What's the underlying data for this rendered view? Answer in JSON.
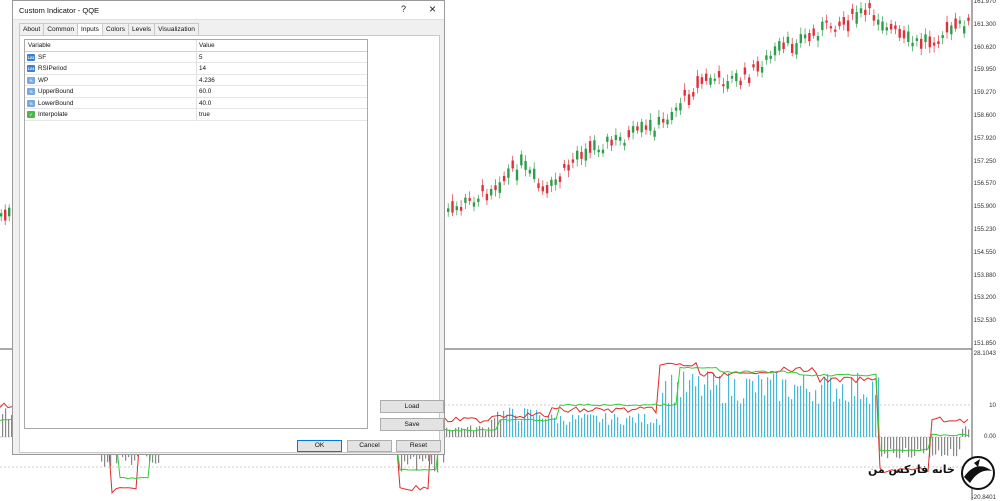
{
  "dialog": {
    "title": "Custom Indicator - QQE",
    "help": "?",
    "close": "×",
    "tabs": [
      "About",
      "Common",
      "Inputs",
      "Colors",
      "Levels",
      "Visualization"
    ],
    "active_tab": "Inputs",
    "grid": {
      "headers": {
        "variable": "Variable",
        "value": "Value"
      },
      "rows": [
        {
          "icon": "number-123-icon",
          "variable": "SF",
          "value": "5"
        },
        {
          "icon": "number-123-icon",
          "variable": "RSIPeriod",
          "value": "14"
        },
        {
          "icon": "fraction-icon",
          "variable": "WP",
          "value": "4.236"
        },
        {
          "icon": "fraction-icon",
          "variable": "UpperBound",
          "value": "60.0"
        },
        {
          "icon": "fraction-icon",
          "variable": "LowerBound",
          "value": "40.0"
        },
        {
          "icon": "checkmark-icon",
          "variable": "Interpolate",
          "value": "true"
        }
      ]
    },
    "buttons": {
      "load": "Load",
      "save": "Save",
      "ok": "OK",
      "cancel": "Cancel",
      "reset": "Reset"
    }
  },
  "price_axis": [
    "161.970",
    "161.300",
    "160.620",
    "159.950",
    "159.270",
    "158.600",
    "157.920",
    "157.250",
    "156.570",
    "155.900",
    "155.230",
    "154.550",
    "153.880",
    "153.200",
    "152.530",
    "151.850"
  ],
  "indicator_axis": [
    "28.1043",
    "10",
    "0.00",
    "-20.8401"
  ],
  "watermark": {
    "text": "خانه فارکس من"
  },
  "colors": {
    "bull": "#2e9e4a",
    "bear": "#e0303a",
    "histogram": "#46b8d8",
    "rsi_line": "#e02a2a",
    "signal_line": "#35c935"
  }
}
